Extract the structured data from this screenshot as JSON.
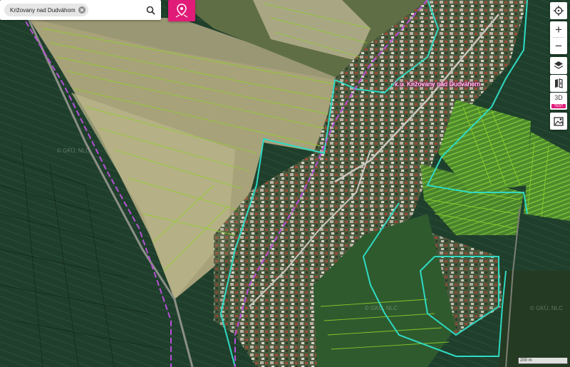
{
  "search": {
    "chip_label": "Križovany nad Dudváhom"
  },
  "map": {
    "parcel_label": "k.ú. Križovany nad Dudváhom",
    "watermark": "© GKÚ, NLC",
    "scale_label": "200 m"
  },
  "toolbar": {
    "zoom_in_label": "+",
    "zoom_out_label": "−",
    "three_d_label": "3D",
    "three_d_badge": "TEST"
  },
  "colors": {
    "accent": "#e01c78",
    "parcel_lines": "#8ed12a",
    "cadastral_boundary": "#2fd9c2",
    "municipal_boundary": "#b74fd8"
  }
}
